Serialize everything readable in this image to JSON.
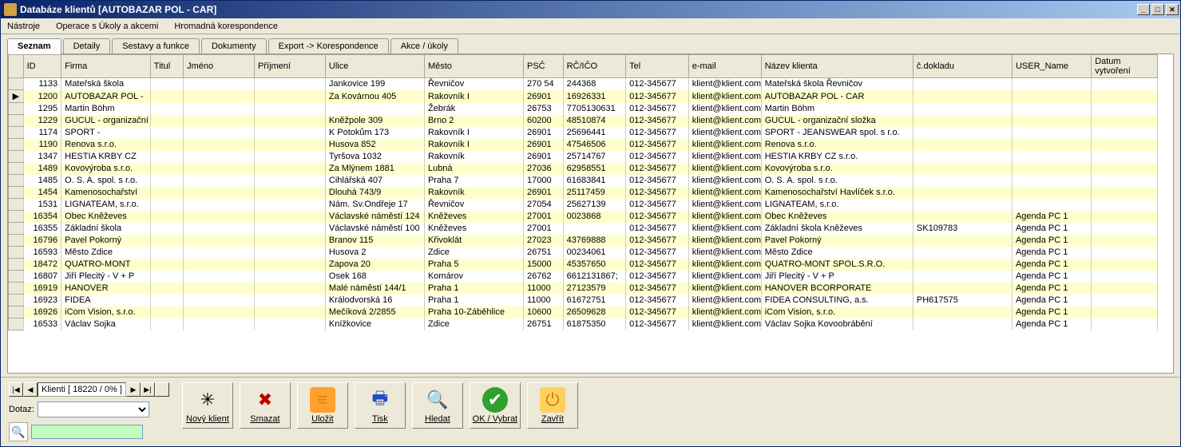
{
  "window": {
    "title": "Databáze klientů   [AUTOBAZAR POL - CAR]"
  },
  "menubar": {
    "items": [
      "Nástroje",
      "Operace s Úkoly a akcemi",
      "Hromadná korespondence"
    ]
  },
  "tabs": {
    "items": [
      {
        "label": "Seznam",
        "active": true
      },
      {
        "label": "Detaily",
        "active": false
      },
      {
        "label": "Sestavy a funkce",
        "active": false
      },
      {
        "label": "Dokumenty",
        "active": false
      },
      {
        "label": "Export -> Korespondence",
        "active": false
      },
      {
        "label": "Akce / úkoly",
        "active": false
      }
    ]
  },
  "grid": {
    "columns": [
      "ID",
      "Firma",
      "Titul",
      "Jméno",
      "Příjmení",
      "Ulice",
      "Město",
      "PSČ",
      "RČ/IČO",
      "Tel",
      "e-mail",
      "Název klienta",
      "č.dokladu",
      "USER_Name",
      "Datum vytvoření"
    ],
    "selected_row": 1,
    "rows": [
      {
        "id": "1133",
        "firma": "Mateřská škola",
        "titul": "",
        "jmeno": "",
        "prijmeni": "",
        "ulice": "Jankovice 199",
        "mesto": "Řevničov",
        "psc": "270 54",
        "rcico": "244368",
        "tel": "012-345677",
        "email": "klient@klient.com",
        "nazev": "Mateřská škola Řevničov",
        "cdokl": "",
        "user": "",
        "datum": ""
      },
      {
        "id": "1200",
        "firma": "AUTOBAZAR POL -",
        "titul": "",
        "jmeno": "",
        "prijmeni": "",
        "ulice": "Za Kovárnou 405",
        "mesto": "Rakovník I",
        "psc": "26901",
        "rcico": "16926331",
        "tel": "012-345677",
        "email": "klient@klient.com",
        "nazev": "AUTOBAZAR POL - CAR",
        "cdokl": "",
        "user": "",
        "datum": ""
      },
      {
        "id": "1295",
        "firma": "Martin Böhm",
        "titul": "",
        "jmeno": "",
        "prijmeni": "",
        "ulice": "",
        "mesto": "Žebrák",
        "psc": "26753",
        "rcico": "7705130631",
        "tel": "012-345677",
        "email": "klient@klient.com",
        "nazev": "Martin Böhm",
        "cdokl": "",
        "user": "",
        "datum": ""
      },
      {
        "id": "1229",
        "firma": "GUCUL - organizační",
        "titul": "",
        "jmeno": "",
        "prijmeni": "",
        "ulice": "Kněžpole 309",
        "mesto": "Brno 2",
        "psc": "60200",
        "rcico": "48510874",
        "tel": "012-345677",
        "email": "klient@klient.com",
        "nazev": "GUCUL - organizační složka",
        "cdokl": "",
        "user": "",
        "datum": ""
      },
      {
        "id": "1174",
        "firma": "SPORT -",
        "titul": "",
        "jmeno": "",
        "prijmeni": "",
        "ulice": " K Potokům 173",
        "mesto": "Rakovník I",
        "psc": "26901",
        "rcico": "25696441",
        "tel": "012-345677",
        "email": "klient@klient.com",
        "nazev": "SPORT - JEANSWEAR spol. s r.o.",
        "cdokl": "",
        "user": "",
        "datum": ""
      },
      {
        "id": "1190",
        "firma": "Renova s.r.o.",
        "titul": "",
        "jmeno": "",
        "prijmeni": "",
        "ulice": "Husova 852",
        "mesto": "Rakovník I",
        "psc": "26901",
        "rcico": "47546506",
        "tel": "012-345677",
        "email": "klient@klient.com",
        "nazev": "Renova s.r.o.",
        "cdokl": "",
        "user": "",
        "datum": ""
      },
      {
        "id": "1347",
        "firma": "HESTIA KRBY CZ",
        "titul": "",
        "jmeno": "",
        "prijmeni": "",
        "ulice": "Tyršova 1032",
        "mesto": "Rakovník",
        "psc": "26901",
        "rcico": "25714767",
        "tel": "012-345677",
        "email": "klient@klient.com",
        "nazev": "HESTIA KRBY CZ s.r.o.",
        "cdokl": "",
        "user": "",
        "datum": ""
      },
      {
        "id": "1489",
        "firma": "Kovovýroba s.r.o.",
        "titul": "",
        "jmeno": "",
        "prijmeni": "",
        "ulice": "Za Mlýnem 1881",
        "mesto": "Lubná",
        "psc": "27036",
        "rcico": "62958551",
        "tel": "012-345677",
        "email": "klient@klient.com",
        "nazev": "Kovovýroba s.r.o.",
        "cdokl": "",
        "user": "",
        "datum": ""
      },
      {
        "id": "1485",
        "firma": "O. S. A. spol. s r.o.",
        "titul": "",
        "jmeno": "",
        "prijmeni": "",
        "ulice": "Cihlářská 407",
        "mesto": "Praha 7",
        "psc": "17000",
        "rcico": "61683841",
        "tel": "012-345677",
        "email": "klient@klient.com",
        "nazev": "O. S. A. spol. s r.o.",
        "cdokl": "",
        "user": "",
        "datum": ""
      },
      {
        "id": "1454",
        "firma": "Kamenosochařství",
        "titul": "",
        "jmeno": "",
        "prijmeni": "",
        "ulice": "Dlouhá 743/9",
        "mesto": "Rakovník",
        "psc": "26901",
        "rcico": "25117459",
        "tel": "012-345677",
        "email": "klient@klient.com",
        "nazev": "Kamenosochařství Havlíček s.r.o.",
        "cdokl": "",
        "user": "",
        "datum": ""
      },
      {
        "id": "1531",
        "firma": "LIGNATEAM, s.r.o.",
        "titul": "",
        "jmeno": "",
        "prijmeni": "",
        "ulice": "Nám. Sv.Ondřeje 17",
        "mesto": "Řevničov",
        "psc": "27054",
        "rcico": "25627139",
        "tel": "012-345677",
        "email": "klient@klient.com",
        "nazev": "LIGNATEAM, s.r.o.",
        "cdokl": "",
        "user": "",
        "datum": ""
      },
      {
        "id": "16354",
        "firma": "Obec Kněževes",
        "titul": "",
        "jmeno": "",
        "prijmeni": "",
        "ulice": "Václavské náměstí 124",
        "mesto": "Kněževes",
        "psc": "27001",
        "rcico": "0023868",
        "tel": "012-345677",
        "email": "klient@klient.com",
        "nazev": "Obec Kněževes",
        "cdokl": "",
        "user": "Agenda PC 1",
        "datum": ""
      },
      {
        "id": "16355",
        "firma": "Základní škola",
        "titul": "",
        "jmeno": "",
        "prijmeni": "",
        "ulice": "Václavské náměstí 100",
        "mesto": "Kněževes",
        "psc": "27001",
        "rcico": "",
        "tel": "012-345677",
        "email": "klient@klient.com",
        "nazev": "Základní škola Kněževes",
        "cdokl": "SK109783",
        "user": "Agenda PC 1",
        "datum": ""
      },
      {
        "id": "16796",
        "firma": "Pavel Pokorný",
        "titul": "",
        "jmeno": "",
        "prijmeni": "",
        "ulice": "Branov 115",
        "mesto": "Křivoklát",
        "psc": "27023",
        "rcico": "43769888",
        "tel": "012-345677",
        "email": "klient@klient.com",
        "nazev": "Pavel Pokorný",
        "cdokl": "",
        "user": "Agenda PC 1",
        "datum": ""
      },
      {
        "id": "16593",
        "firma": "Město Zdice",
        "titul": "",
        "jmeno": "",
        "prijmeni": "",
        "ulice": "Husova 2",
        "mesto": "Zdice",
        "psc": "26751",
        "rcico": "00234061",
        "tel": "012-345677",
        "email": "klient@klient.com",
        "nazev": "Město Zdice",
        "cdokl": "",
        "user": "Agenda PC 1",
        "datum": ""
      },
      {
        "id": "18472",
        "firma": "QUATRO-MONT",
        "titul": "",
        "jmeno": "",
        "prijmeni": "",
        "ulice": "Zapova 20",
        "mesto": "Praha 5",
        "psc": "15000",
        "rcico": "45357650",
        "tel": "012-345677",
        "email": "klient@klient.com",
        "nazev": "QUATRO-MONT SPOL.S.R.O.",
        "cdokl": "",
        "user": "Agenda PC 1",
        "datum": ""
      },
      {
        "id": "16807",
        "firma": "Jiří Plecitý - V + P",
        "titul": "",
        "jmeno": "",
        "prijmeni": "",
        "ulice": "Osek 168",
        "mesto": "Komárov",
        "psc": "26762",
        "rcico": "6612131867;",
        "tel": "012-345677",
        "email": "klient@klient.com",
        "nazev": "Jiří Plecitý - V + P",
        "cdokl": "",
        "user": "Agenda PC 1",
        "datum": ""
      },
      {
        "id": "16919",
        "firma": "HANOVER",
        "titul": "",
        "jmeno": "",
        "prijmeni": "",
        "ulice": "Malé náměstí 144/1",
        "mesto": "Praha 1",
        "psc": "11000",
        "rcico": "27123579",
        "tel": "012-345677",
        "email": "klient@klient.com",
        "nazev": "HANOVER BCORPORATE",
        "cdokl": "",
        "user": "Agenda PC 1",
        "datum": ""
      },
      {
        "id": "16923",
        "firma": "FIDEA",
        "titul": "",
        "jmeno": "",
        "prijmeni": "",
        "ulice": "Králodvorská 16",
        "mesto": "Praha 1",
        "psc": "11000",
        "rcico": "61672751",
        "tel": "012-345677",
        "email": "klient@klient.com",
        "nazev": "FIDEA CONSULTING, a.s.",
        "cdokl": "PH617575",
        "user": "Agenda PC 1",
        "datum": ""
      },
      {
        "id": "16926",
        "firma": "iCom Vision, s.r.o.",
        "titul": "",
        "jmeno": "",
        "prijmeni": "",
        "ulice": "Mečíková 2/2855",
        "mesto": "Praha 10-Záběhlice",
        "psc": "10600",
        "rcico": "26509628",
        "tel": "012-345677",
        "email": "klient@klient.com",
        "nazev": "iCom Vision, s.r.o.",
        "cdokl": "",
        "user": "Agenda PC 1",
        "datum": ""
      },
      {
        "id": "16533",
        "firma": "Václav Sojka",
        "titul": "",
        "jmeno": "",
        "prijmeni": "",
        "ulice": "Knížkovice",
        "mesto": "Zdice",
        "psc": "26751",
        "rcico": "61875350",
        "tel": "012-345677",
        "email": "klient@klient.com",
        "nazev": "Václav Sojka Kovoobrábění",
        "cdokl": "",
        "user": "Agenda PC 1",
        "datum": ""
      }
    ]
  },
  "navigator": {
    "label": "Klienti [ 18220 / 0% ]"
  },
  "dotaz": {
    "label": "Dotaz:"
  },
  "toolbar": {
    "buttons": [
      {
        "label": "Nový klient",
        "icon": "✳",
        "cls": ""
      },
      {
        "label": "Smazat",
        "icon": "✖",
        "cls": "c-red"
      },
      {
        "label": "Uložit",
        "icon": "≡",
        "cls": "c-orange"
      },
      {
        "label": "Tisk",
        "icon": "🖶",
        "cls": "c-blue"
      },
      {
        "label": "Hledat",
        "icon": "🔍",
        "cls": "c-blue"
      },
      {
        "label": "OK / Vybrat",
        "icon": "✔",
        "cls": "c-green"
      },
      {
        "label": "Zavřít",
        "icon": "⏻",
        "cls": "c-yellow"
      }
    ]
  }
}
